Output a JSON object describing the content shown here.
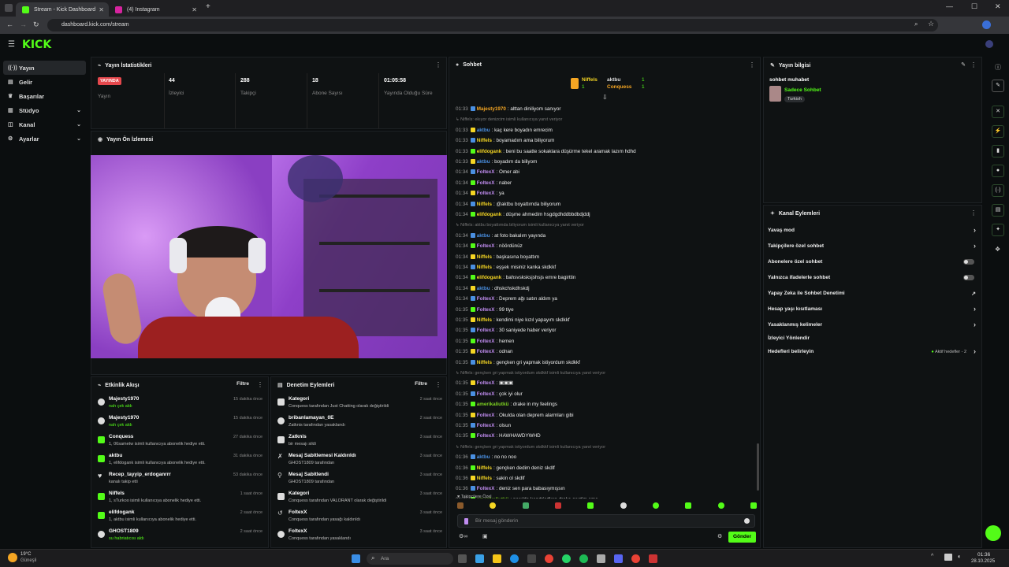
{
  "browser": {
    "tabs": [
      {
        "label": "Stream - Kick Dashboard",
        "active": true
      },
      {
        "label": "(4) Instagram",
        "active": false
      }
    ],
    "url": "dashboard.kick.com/stream"
  },
  "app": {
    "logo": "KICK"
  },
  "sidebar": {
    "items": [
      {
        "label": "Yayın",
        "icon": "broadcast-icon"
      },
      {
        "label": "Gelir",
        "icon": "wallet-icon"
      },
      {
        "label": "Başarılar",
        "icon": "trophy-icon"
      },
      {
        "label": "Stüdyo",
        "icon": "studio-icon"
      },
      {
        "label": "Kanal",
        "icon": "channel-icon"
      },
      {
        "label": "Ayarlar",
        "icon": "gear-icon"
      }
    ]
  },
  "stats": {
    "title": "Yayın İstatistikleri",
    "live_badge": "YAYINDA",
    "live_label": "Yayın",
    "items": [
      {
        "value": "44",
        "label": "İzleyici"
      },
      {
        "value": "288",
        "label": "Takipçi"
      },
      {
        "value": "18",
        "label": "Abone Sayısı"
      },
      {
        "value": "01:05:58",
        "label": "Yayında Olduğu Süre"
      }
    ]
  },
  "preview": {
    "title": "Yayın Ön İzlemesi"
  },
  "activity": {
    "title": "Etkinlik Akışı",
    "filter": "Filtre",
    "items": [
      {
        "name": "Majesty1970",
        "desc": "nah çek aldı",
        "time": "15 dakika önce"
      },
      {
        "name": "Majesty1970",
        "desc": "nah çek aldı",
        "time": "15 dakika önce"
      },
      {
        "name": "Conquess",
        "desc": "1, 06sametw isimli kullanıcıya abonelik hediye etti.",
        "time": "27 dakika önce"
      },
      {
        "name": "aktbu",
        "desc": "1, elifdogank isimli kullanıcıya abonelik hediye etti.",
        "time": "31 dakika önce"
      },
      {
        "name": "Recep_tayyip_erdoganrrr",
        "desc": "kanalı takip etti",
        "time": "53 dakika önce"
      },
      {
        "name": "Niffels",
        "desc": "1, sTurkoo isimli kullanıcıya abonelik hediye etti.",
        "time": "1 saat önce"
      },
      {
        "name": "elifdogank",
        "desc": "1, aktbu isimli kullanıcıya abonelik hediye etti.",
        "time": "2 saat önce"
      },
      {
        "name": "GHOST1809",
        "desc": "su habriatıcısı aldı",
        "time": "2 saat önce"
      }
    ]
  },
  "moderation": {
    "title": "Denetim Eylemleri",
    "filter": "Filtre",
    "items": [
      {
        "name": "Kategori",
        "desc": "Conquess tarafından Just Chatting olarak değiştirildi",
        "time": "2 saat önce"
      },
      {
        "name": "bribanlamayan_0E",
        "desc": "Zatknis tarafından yasaklandı",
        "time": "2 saat önce"
      },
      {
        "name": "Zatknis",
        "desc": "bir mesajı sildi",
        "time": "3 saat önce"
      },
      {
        "name": "Mesaj Sabitlemesi Kaldırıldı",
        "desc": "GHOST1809 tarafından",
        "time": "3 saat önce"
      },
      {
        "name": "Mesaj Sabitlendi",
        "desc": "GHOST1809 tarafından",
        "time": "3 saat önce"
      },
      {
        "name": "Kategori",
        "desc": "Conquess tarafından VALORANT olarak değiştirildi",
        "time": "3 saat önce"
      },
      {
        "name": "FoltexX",
        "desc": "Conquess tarafından yasağı kaldırıldı",
        "time": "3 saat önce"
      },
      {
        "name": "FoltexX",
        "desc": "Conquess tarafından yasaklandı",
        "time": "3 saat önce"
      }
    ]
  },
  "chat": {
    "title": "Sohbet",
    "leaders": [
      {
        "name": "Niffels",
        "count": "1"
      },
      {
        "name": "aktbu",
        "count": "1"
      },
      {
        "name": "Conquess",
        "count": "1"
      }
    ],
    "messages": [
      {
        "time": "01:33",
        "user": "Majesty1970",
        "color": "#f5a623",
        "text": "alttan diniliyom sanıyor"
      },
      {
        "time": "",
        "user": "",
        "color": "#777",
        "text": "↳ Niffels: ekıyor denizcim isimli kullanıcıya yanıt veriyor",
        "reply": true
      },
      {
        "time": "01:33",
        "user": "aktbu",
        "color": "#4a90e2",
        "text": "kaç kere boyadın emrecim"
      },
      {
        "time": "01:33",
        "user": "Niffels",
        "color": "#f5d623",
        "text": "boyamadım ama biliyorum"
      },
      {
        "time": "01:33",
        "user": "elifdogank",
        "color": "#f5d623",
        "text": "beni bu saatte sokaklara düşürme tekel aramak lazım hdhd"
      },
      {
        "time": "01:33",
        "user": "aktbu",
        "color": "#4a90e2",
        "text": "boyadım da biliyom"
      },
      {
        "time": "01:34",
        "user": "FoltexX",
        "color": "#c08cf0",
        "text": "Ömer abi"
      },
      {
        "time": "01:34",
        "user": "FoltexX",
        "color": "#c08cf0",
        "text": "naber"
      },
      {
        "time": "01:34",
        "user": "FoltexX",
        "color": "#c08cf0",
        "text": "ya"
      },
      {
        "time": "01:34",
        "user": "Niffels",
        "color": "#f5d623",
        "text": "@aktbu boyattımda biliyorum"
      },
      {
        "time": "01:34",
        "user": "elifdogank",
        "color": "#f5d623",
        "text": "düşme ahmedim hsgdgdhddbbdbdjddj"
      },
      {
        "time": "",
        "user": "",
        "color": "#777",
        "text": "↳ Niffels: aktbu boyattımda biliyorum isimli kullanıcıya yanıt veriyor",
        "reply": true
      },
      {
        "time": "01:34",
        "user": "aktbu",
        "color": "#4a90e2",
        "text": "at foto bakalım yayında"
      },
      {
        "time": "01:34",
        "user": "FoltexX",
        "color": "#c08cf0",
        "text": "nöördünüz"
      },
      {
        "time": "01:34",
        "user": "Niffels",
        "color": "#f5d623",
        "text": "başkasına boyattım"
      },
      {
        "time": "01:34",
        "user": "Niffels",
        "color": "#f5d623",
        "text": "eşşek misiniz kanka skdkkf"
      },
      {
        "time": "01:34",
        "user": "elifdogank",
        "color": "#f5d623",
        "text": "bahsvsksksjshsjs emre bagirttin"
      },
      {
        "time": "01:34",
        "user": "aktbu",
        "color": "#4a90e2",
        "text": "dhskchskdhskdj"
      },
      {
        "time": "01:34",
        "user": "FoltexX",
        "color": "#c08cf0",
        "text": "Deprem ağı satın aldım ya"
      },
      {
        "time": "01:35",
        "user": "FoltexX",
        "color": "#c08cf0",
        "text": "99 tlye"
      },
      {
        "time": "01:35",
        "user": "Niffels",
        "color": "#f5d623",
        "text": "kendimi niye kızıl yapayım skdkkf"
      },
      {
        "time": "01:35",
        "user": "FoltexX",
        "color": "#c08cf0",
        "text": "30 saniyede haber veriyor"
      },
      {
        "time": "01:35",
        "user": "FoltexX",
        "color": "#c08cf0",
        "text": "hemen"
      },
      {
        "time": "01:35",
        "user": "FoltexX",
        "color": "#c08cf0",
        "text": "odnan"
      },
      {
        "time": "01:35",
        "user": "Niffels",
        "color": "#f5d623",
        "text": "gençken gri yapmak istiyordum skdkkf"
      },
      {
        "time": "",
        "user": "",
        "color": "#777",
        "text": "↳ Niffels: gençken gri yapmak istiyordum skdkkf isimli kullanıcıya yanıt veriyor",
        "reply": true
      },
      {
        "time": "01:35",
        "user": "FoltexX",
        "color": "#c08cf0",
        "text": "▣▣▣"
      },
      {
        "time": "01:35",
        "user": "FoltexX",
        "color": "#c08cf0",
        "text": "çok iyi olur"
      },
      {
        "time": "01:35",
        "user": "amerikaliutkü",
        "color": "#7ed321",
        "text": "drake in my feelings"
      },
      {
        "time": "01:35",
        "user": "FoltexX",
        "color": "#c08cf0",
        "text": "Okulda olan deprem alarmları gibi"
      },
      {
        "time": "01:35",
        "user": "FoltexX",
        "color": "#c08cf0",
        "text": "olsun"
      },
      {
        "time": "01:35",
        "user": "FoltexX",
        "color": "#c08cf0",
        "text": "HAWHAWDYWHD"
      },
      {
        "time": "",
        "user": "",
        "color": "#777",
        "text": "↳ Niffels: gençken gri yapmak istiyordum skdkkf isimli kullanıcıya yanıt veriyor",
        "reply": true
      },
      {
        "time": "01:36",
        "user": "aktbu",
        "color": "#4a90e2",
        "text": "no no noo"
      },
      {
        "time": "01:36",
        "user": "Niffels",
        "color": "#f5d623",
        "text": "gençken dedim deniz skdlf"
      },
      {
        "time": "01:36",
        "user": "Niffels",
        "color": "#f5d623",
        "text": "sakin ol skdlf"
      },
      {
        "time": "01:36",
        "user": "FoltexX",
        "color": "#c08cf0",
        "text": "deniz sen para babasıymışsın"
      },
      {
        "time": "01:36",
        "user": "amerikaliutkü",
        "color": "#7ed321",
        "text": "nasılda kendricdken drake geçtim ama"
      }
    ],
    "followers_only_label": "Takipçilere Özel",
    "input_placeholder": "Bir mesaj gönderin",
    "send_label": "Gönder"
  },
  "stream_info": {
    "title": "Yayın bilgisi",
    "stream_title": "sohbet muhabet",
    "category": "Sadece Sohbet",
    "tag": "Turkish"
  },
  "channel_actions": {
    "title": "Kanal Eylemleri",
    "items": [
      {
        "label": "Yavaş mod",
        "control": "chevron"
      },
      {
        "label": "Takipçilere özel sohbet",
        "control": "chevron"
      },
      {
        "label": "Abonelere özel sohbet",
        "control": "toggle"
      },
      {
        "label": "Yalnızca ifadelerle sohbet",
        "control": "toggle"
      },
      {
        "label": "Yapay Zeka ile Sohbet Denetimi",
        "control": "external"
      },
      {
        "label": "Hesap yaşı kısıtlaması",
        "control": "chevron"
      },
      {
        "label": "Yasaklanmış kelimeler",
        "control": "chevron"
      },
      {
        "label": "İzleyici Yönlendir",
        "control": "none"
      },
      {
        "label": "Hedefleri belirleyin",
        "control": "chevron",
        "extra": "Aktif hedefler - 2"
      }
    ]
  },
  "taskbar": {
    "weather_temp": "19°C",
    "weather_desc": "Güneşli",
    "search_placeholder": "Ara",
    "time": "01:36",
    "date": "28.10.2025"
  },
  "colors": {
    "accent": "#53fc18",
    "live": "#e5484d"
  }
}
